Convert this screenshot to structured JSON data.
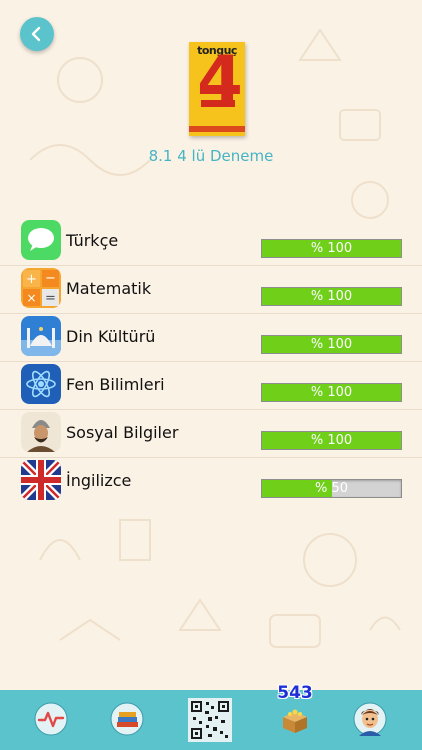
{
  "header": {
    "back_icon": "chevron-left-icon",
    "book_cover": {
      "brand": "tonguç",
      "number": "4"
    },
    "title": "8.1 4 lü Deneme"
  },
  "subjects": [
    {
      "label": "Türkçe",
      "icon": "speech-bubble-icon",
      "progress_text": "% 100",
      "progress": 100
    },
    {
      "label": "Matematik",
      "icon": "calculator-icon",
      "progress_text": "% 100",
      "progress": 100
    },
    {
      "label": "Din Kültürü",
      "icon": "mosque-icon",
      "progress_text": "% 100",
      "progress": 100
    },
    {
      "label": "Fen Bilimleri",
      "icon": "atom-icon",
      "progress_text": "% 100",
      "progress": 100
    },
    {
      "label": "Sosyal Bilgiler",
      "icon": "historical-figure-icon",
      "progress_text": "% 100",
      "progress": 100
    },
    {
      "label": "İngilizce",
      "icon": "uk-flag-icon",
      "progress_text": "% 50",
      "progress": 50
    }
  ],
  "tabbar": {
    "coin_count": "543",
    "tabs": [
      "heartbeat-icon",
      "books-icon",
      "qr-code-icon",
      "treasure-box-icon",
      "avatar-icon"
    ]
  },
  "colors": {
    "accent": "#5bc3cc",
    "title": "#45b4c4",
    "progress_fill": "#6fcf19",
    "background": "#fbf2e6"
  }
}
